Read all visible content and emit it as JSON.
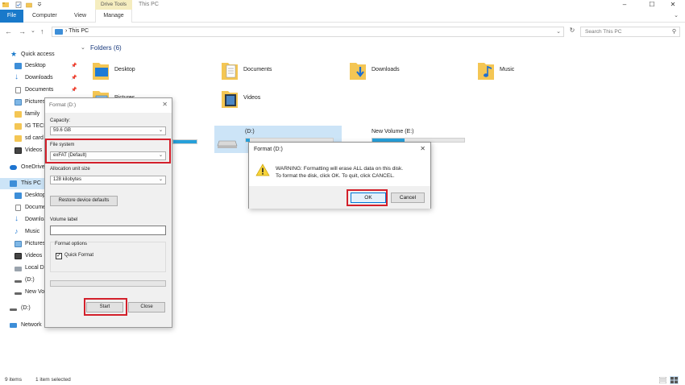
{
  "window": {
    "title": "This PC",
    "contextual_group": "Drive Tools",
    "minimize": "–",
    "maximize": "☐",
    "close": "✕"
  },
  "ribbon": {
    "tabs": [
      "File",
      "Computer",
      "View",
      "Manage"
    ],
    "toggle": "⌄"
  },
  "nav": {
    "back": "←",
    "forward": "→",
    "recent": "⌄",
    "up": "↑",
    "address": "› This PC",
    "address_dropdown": "⌄",
    "refresh": "↻",
    "search_placeholder": "Search This PC",
    "search_icon": "⚲"
  },
  "sidebar": {
    "items": [
      {
        "label": "Quick access",
        "icon": "star-icon",
        "pinned": false
      },
      {
        "label": "Desktop",
        "icon": "desktop-icon",
        "pinned": true
      },
      {
        "label": "Downloads",
        "icon": "downloads-icon",
        "pinned": true
      },
      {
        "label": "Documents",
        "icon": "documents-icon",
        "pinned": true
      },
      {
        "label": "Pictures",
        "icon": "pictures-icon",
        "pinned": true
      },
      {
        "label": "family",
        "icon": "folder-icon",
        "pinned": false
      },
      {
        "label": "IG TECH",
        "icon": "folder-icon",
        "pinned": false
      },
      {
        "label": "sd card",
        "icon": "folder-icon",
        "pinned": false
      },
      {
        "label": "Videos",
        "icon": "videos-icon",
        "pinned": false
      },
      {
        "label": "OneDrive",
        "icon": "onedrive-icon",
        "pinned": false
      },
      {
        "label": "This PC",
        "icon": "pc-icon",
        "pinned": false
      },
      {
        "label": "Desktop",
        "icon": "desktop-icon",
        "pinned": false
      },
      {
        "label": "Documents",
        "icon": "documents-icon",
        "pinned": false
      },
      {
        "label": "Downloads",
        "icon": "downloads-icon",
        "pinned": false
      },
      {
        "label": "Music",
        "icon": "music-icon",
        "pinned": false
      },
      {
        "label": "Pictures",
        "icon": "pictures-icon",
        "pinned": false
      },
      {
        "label": "Videos",
        "icon": "videos-icon",
        "pinned": false
      },
      {
        "label": "Local Disk",
        "icon": "disk-icon",
        "pinned": false
      },
      {
        "label": "(D:)",
        "icon": "drive-icon",
        "pinned": false
      },
      {
        "label": "New Volume",
        "icon": "drive-icon",
        "pinned": false
      },
      {
        "label": "(D:)",
        "icon": "drive-icon",
        "pinned": false
      },
      {
        "label": "Network",
        "icon": "network-icon",
        "pinned": false
      }
    ],
    "pin_glyph": "📌"
  },
  "main": {
    "folders_header": "Folders (6)",
    "folders_chevron": "⌄",
    "folders": [
      {
        "label": "Desktop",
        "icon": "desktop-folder-icon"
      },
      {
        "label": "Documents",
        "icon": "documents-folder-icon"
      },
      {
        "label": "Downloads",
        "icon": "downloads-folder-icon"
      },
      {
        "label": "Music",
        "icon": "music-folder-icon"
      },
      {
        "label": "Pictures",
        "icon": "pictures-folder-icon"
      },
      {
        "label": "Videos",
        "icon": "videos-folder-icon"
      }
    ],
    "drives": [
      {
        "label": "(D:)",
        "fill": 0.05
      },
      {
        "label": "New Volume (E:)",
        "fill": 0.35
      }
    ]
  },
  "status": {
    "items": "9 items",
    "selected": "1 item selected"
  },
  "format_dialog": {
    "title": "Format  (D:)",
    "close": "✕",
    "capacity_label": "Capacity:",
    "capacity_value": "59.6 GB",
    "filesystem_label": "File system",
    "filesystem_value": "exFAT (Default)",
    "allocation_label": "Allocation unit size",
    "allocation_value": "128 kilobytes",
    "restore_button": "Restore device defaults",
    "volume_label": "Volume label",
    "volume_value": "",
    "options_label": "Format options",
    "quick_format_label": "Quick Format",
    "quick_format_checked": "✓",
    "start_button": "Start",
    "close_button": "Close",
    "dropdown_glyph": "⌄"
  },
  "warning_dialog": {
    "title": "Format  (D:)",
    "close": "✕",
    "line1": "WARNING: Formatting will erase ALL data on this disk.",
    "line2": "To format the disk, click OK. To quit, click CANCEL.",
    "ok_button": "OK",
    "cancel_button": "Cancel"
  },
  "colors": {
    "accent": "#1979ca",
    "highlight": "#d3202b",
    "folder_yellow": "#f4c654",
    "drive_fill": "#26a0da"
  }
}
